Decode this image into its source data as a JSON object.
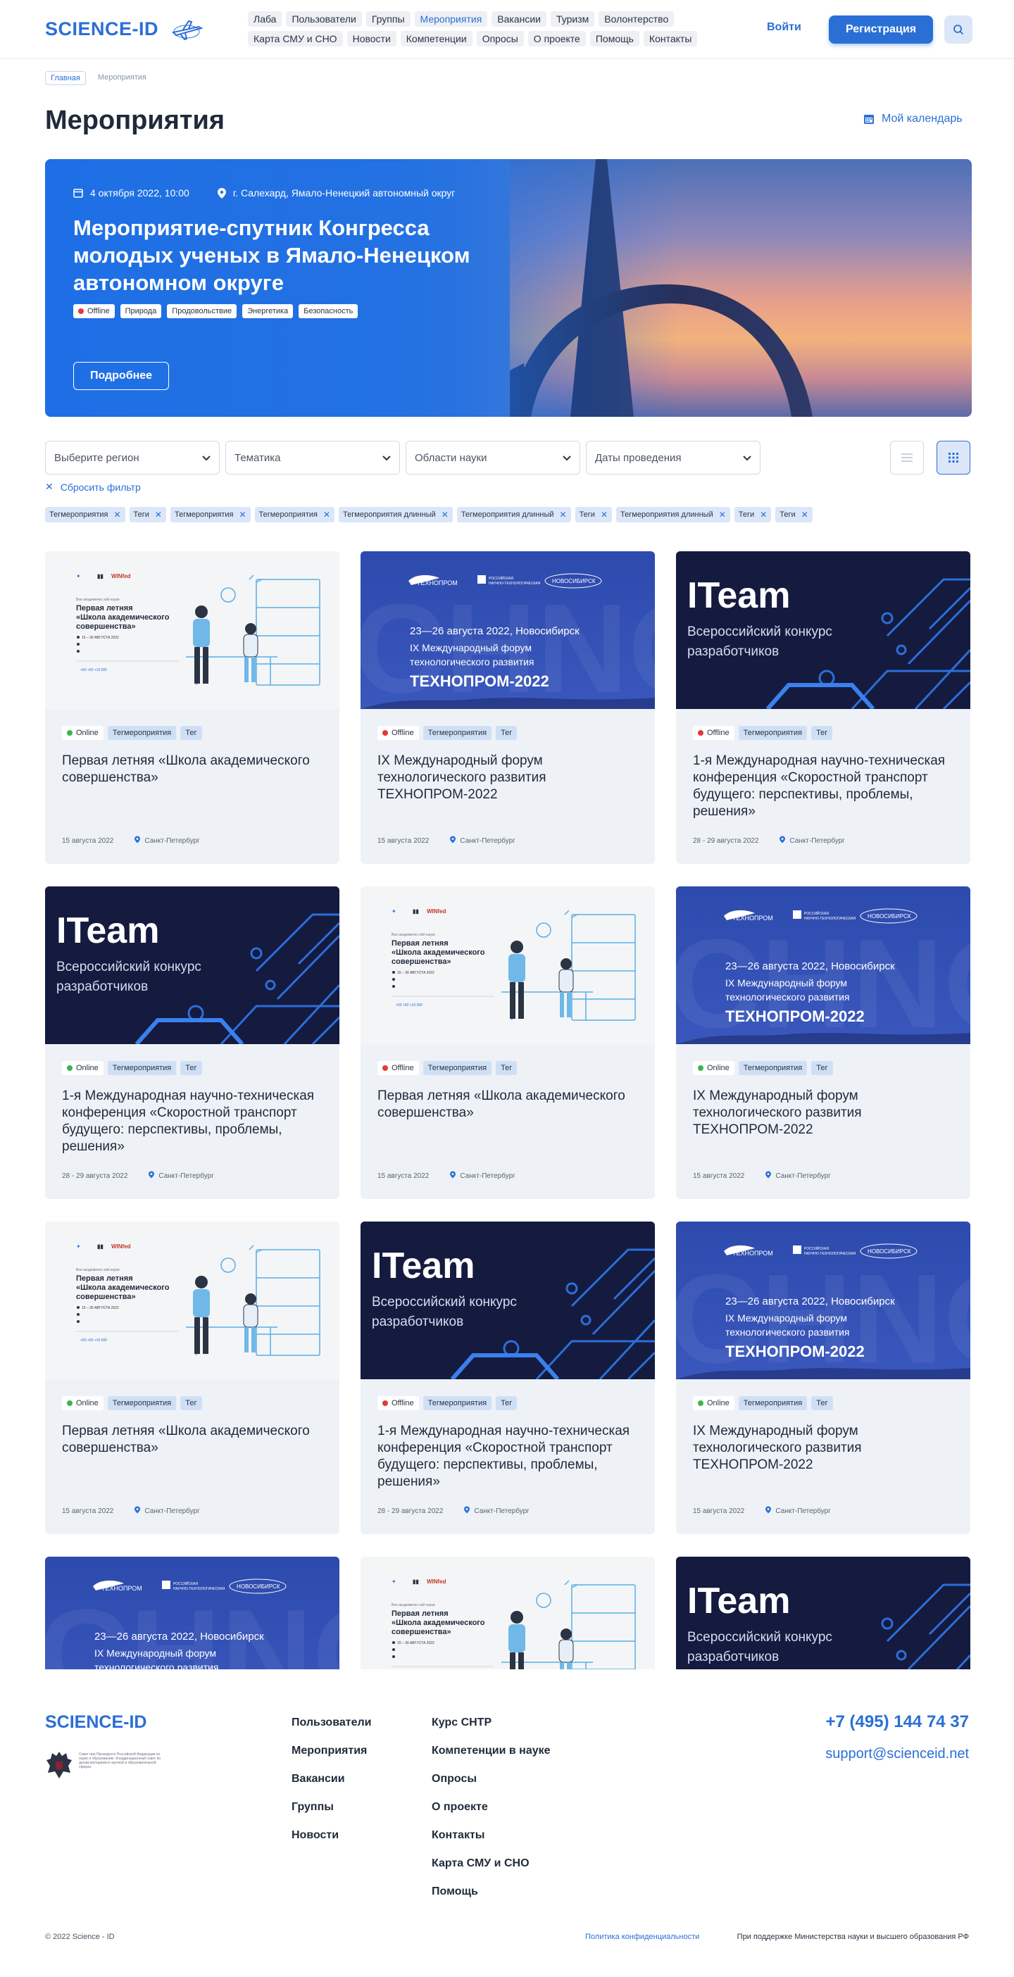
{
  "header": {
    "logo": "SCIENCE-ID",
    "nav": [
      "Лаба",
      "Пользователи",
      "Группы",
      "Мероприятия",
      "Вакансии",
      "Туризм",
      "Волонтерство",
      "Карта СМУ и СНО",
      "Новости",
      "Компетенции",
      "Опросы",
      "О проекте",
      "Помощь",
      "Контакты"
    ],
    "active_nav": "Мероприятия",
    "login": "Войти",
    "register": "Регистрация"
  },
  "breadcrumbs": [
    "Главная",
    "Мероприятия"
  ],
  "page_title": "Мероприятия",
  "calendar_link": "Мой календарь",
  "hero": {
    "date": "4 октября 2022, 10:00",
    "location": "г. Салехард, Ямало-Ненецкий автономный округ",
    "title": "Мероприятие-спутник Конгресса молодых ученых в Ямало-Ненецком автономном округе",
    "tags": [
      "Offline",
      "Природа",
      "Продовольствие",
      "Энергетика",
      "Безопасность"
    ],
    "button": "Подробнее"
  },
  "filters": {
    "selects": [
      "Выберите регион",
      "Тематика",
      "Области науки",
      "Даты проведения"
    ],
    "reset": "Сбросить фильтр",
    "chips": [
      "Тегмероприятия",
      "Теги",
      "Тегмероприятия",
      "Тегмероприятия",
      "Тегмероприятия длинный",
      "Тегмероприятия длинный",
      "Теги",
      "Тегмероприятия длинный",
      "Теги",
      "Теги"
    ]
  },
  "cards": [
    {
      "image": "school",
      "status": "Online",
      "tags": [
        "Тегмероприятия",
        "Тег"
      ],
      "title": "Первая летняя «Школа академического совершенства»",
      "date": "15 августа 2022",
      "city": "Санкт-Петербург"
    },
    {
      "image": "tech",
      "status": "Offline",
      "tags": [
        "Тегмероприятия",
        "Тег"
      ],
      "title": "IX Международный форум технологического развития ТЕХНОПРОМ-2022",
      "date": "15 августа 2022",
      "city": "Санкт-Петербург"
    },
    {
      "image": "iteam",
      "status": "Offline",
      "tags": [
        "Тегмероприятия",
        "Тег"
      ],
      "title": "1-я Международная научно-техническая конференция «Скоростной транспорт будущего: перспективы, проблемы, решения»",
      "date": "28 - 29 августа 2022",
      "city": "Санкт-Петербург"
    },
    {
      "image": "iteam",
      "status": "Online",
      "tags": [
        "Тегмероприятия",
        "Тег"
      ],
      "title": "1-я Международная научно-техническая конференция «Скоростной транспорт будущего: перспективы, проблемы, решения»",
      "date": "28 - 29 августа 2022",
      "city": "Санкт-Петербург"
    },
    {
      "image": "school",
      "status": "Offline",
      "tags": [
        "Тегмероприятия",
        "Тег"
      ],
      "title": "Первая летняя «Школа академического совершенства»",
      "date": "15 августа 2022",
      "city": "Санкт-Петербург"
    },
    {
      "image": "tech",
      "status": "Online",
      "tags": [
        "Тегмероприятия",
        "Тег"
      ],
      "title": "IX Международный форум технологического развития ТЕХНОПРОМ-2022",
      "date": "15 августа 2022",
      "city": "Санкт-Петербург"
    },
    {
      "image": "school",
      "status": "Online",
      "tags": [
        "Тегмероприятия",
        "Тег"
      ],
      "title": "Первая летняя «Школа академического совершенства»",
      "date": "15 августа 2022",
      "city": "Санкт-Петербург"
    },
    {
      "image": "iteam",
      "status": "Offline",
      "tags": [
        "Тегмероприятия",
        "Тег"
      ],
      "title": "1-я Международная научно-техническая конференция «Скоростной транспорт будущего: перспективы, проблемы, решения»",
      "date": "28 - 29 августа 2022",
      "city": "Санкт-Петербург"
    },
    {
      "image": "tech",
      "status": "Online",
      "tags": [
        "Тегмероприятия",
        "Тег"
      ],
      "title": "IX Международный форум технологического развития ТЕХНОПРОМ-2022",
      "date": "15 августа 2022",
      "city": "Санкт-Петербург"
    },
    {
      "image": "tech",
      "status": "",
      "tags": [],
      "title": "",
      "date": "",
      "city": ""
    },
    {
      "image": "school",
      "status": "",
      "tags": [],
      "title": "",
      "date": "",
      "city": ""
    },
    {
      "image": "iteam",
      "status": "",
      "tags": [],
      "title": "",
      "date": "",
      "city": ""
    }
  ],
  "image_text": {
    "school_pre": "Вне академичес кой науки",
    "school_title": "Первая летняя «Школа академического совершенства»",
    "school_dates": "15 – 30 АВГУСТА 2022",
    "school_brand": "WINfed",
    "tech_date": "23—26 августа 2022, Новосибирск",
    "tech_sub": "IX Международный форум технологического развития",
    "tech_main": "ТЕХНОПРОМ-2022",
    "tech_logo": "ТЕХНОПРОМ",
    "tech_city": "НОВОСИБИРСК",
    "iteam_title": "ITeam",
    "iteam_sub": "Всероссийский конкурс разработчиков"
  },
  "footer": {
    "logo": "SCIENCE-ID",
    "emblem_text": "Совет при Президенте Российской Федерации по науке и образованию. Координационный совет по делам молодёжи в научной и образовательной сферах",
    "col1": [
      "Пользователи",
      "Мероприятия",
      "Вакансии",
      "Группы",
      "Новости"
    ],
    "col2": [
      "Курс СНТР",
      "Компетенции в науке",
      "Опросы",
      "О проекте",
      "Контакты",
      "Карта СМУ и СНО",
      "Помощь"
    ],
    "phone": "+7 (495) 144 74 37",
    "email": "support@scienceid.net",
    "copyright": "© 2022 Science - ID",
    "policy": "Политика конфиденциальности",
    "support": "При поддержке Министерства науки и высшего образования РФ"
  },
  "colors": {
    "accent": "#2a6fd6",
    "online": "#3cb54a",
    "offline": "#e53935"
  }
}
